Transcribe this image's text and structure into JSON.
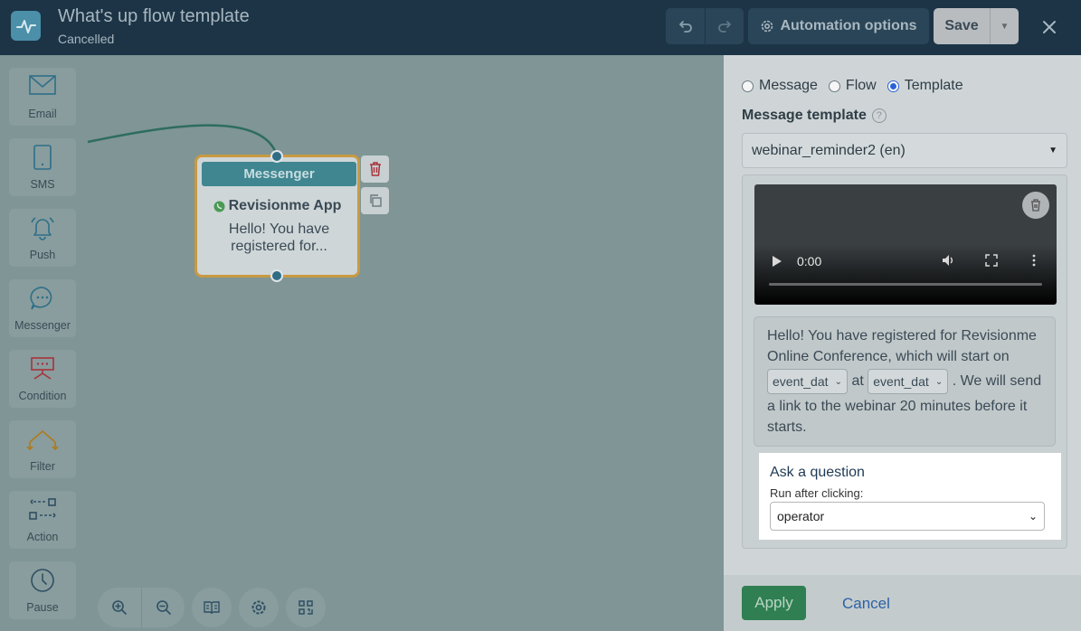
{
  "header": {
    "title": "What's up flow template",
    "status": "Cancelled",
    "automation_label": "Automation options",
    "save_label": "Save"
  },
  "toolbox": {
    "items": [
      {
        "label": "Email",
        "icon": "envelope-icon"
      },
      {
        "label": "SMS",
        "icon": "phone-icon"
      },
      {
        "label": "Push",
        "icon": "bell-icon"
      },
      {
        "label": "Messenger",
        "icon": "chat-icon"
      },
      {
        "label": "Condition",
        "icon": "condition-icon"
      },
      {
        "label": "Filter",
        "icon": "filter-icon"
      },
      {
        "label": "Action",
        "icon": "action-icon"
      },
      {
        "label": "Pause",
        "icon": "clock-icon"
      }
    ]
  },
  "canvas": {
    "node": {
      "header": "Messenger",
      "app": "Revisionme App",
      "text": "Hello! You have registered for..."
    }
  },
  "panel": {
    "radio_options": [
      "Message",
      "Flow",
      "Template"
    ],
    "selected_radio": "Template",
    "template_label": "Message template",
    "template_value": "webinar_reminder2 (en)",
    "video_time": "0:00",
    "message": {
      "line1": "Hello! You have registered for Revisionme Online Conference, which will start on",
      "var1": "event_dat",
      "mid": "at",
      "var2": "event_dat",
      "end": ".",
      "line2": "We will send a link to the webinar 20 minutes before it starts."
    },
    "ask": {
      "title": "Ask a question",
      "sub": "Run after clicking:",
      "value": "operator"
    },
    "apply_label": "Apply",
    "cancel_label": "Cancel"
  }
}
